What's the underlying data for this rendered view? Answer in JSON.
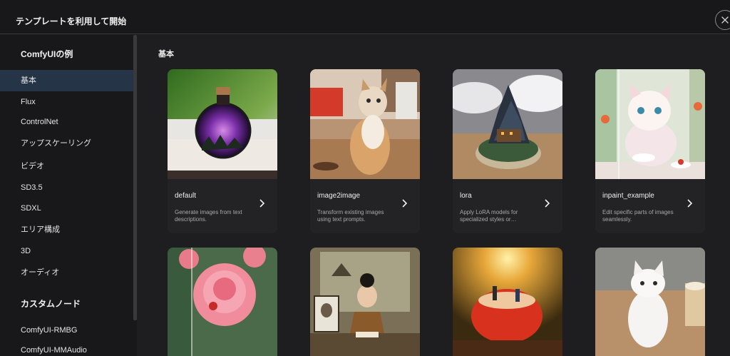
{
  "header": {
    "title": "テンプレートを利用して開始"
  },
  "sidebar": {
    "heading": "ComfyUIの例",
    "items": [
      {
        "label": "基本",
        "active": true
      },
      {
        "label": "Flux"
      },
      {
        "label": "ControlNet"
      },
      {
        "label": "アップスケーリング"
      },
      {
        "label": "ビデオ"
      },
      {
        "label": "SD3.5"
      },
      {
        "label": "SDXL"
      },
      {
        "label": "エリア構成"
      },
      {
        "label": "3D"
      },
      {
        "label": "オーディオ"
      }
    ],
    "custom_heading": "カスタムノード",
    "custom_items": [
      {
        "label": "ComfyUI-RMBG"
      },
      {
        "label": "ComfyUI-MMAudio"
      }
    ]
  },
  "main": {
    "section_title": "基本",
    "cards": [
      {
        "title": "default",
        "desc": "Generate images from text descriptions."
      },
      {
        "title": "image2image",
        "desc": "Transform existing images using text prompts."
      },
      {
        "title": "lora",
        "desc": "Apply LoRA models for specialized styles or…"
      },
      {
        "title": "inpaint_example",
        "desc": "Edit specific parts of images seamlessly."
      }
    ]
  }
}
